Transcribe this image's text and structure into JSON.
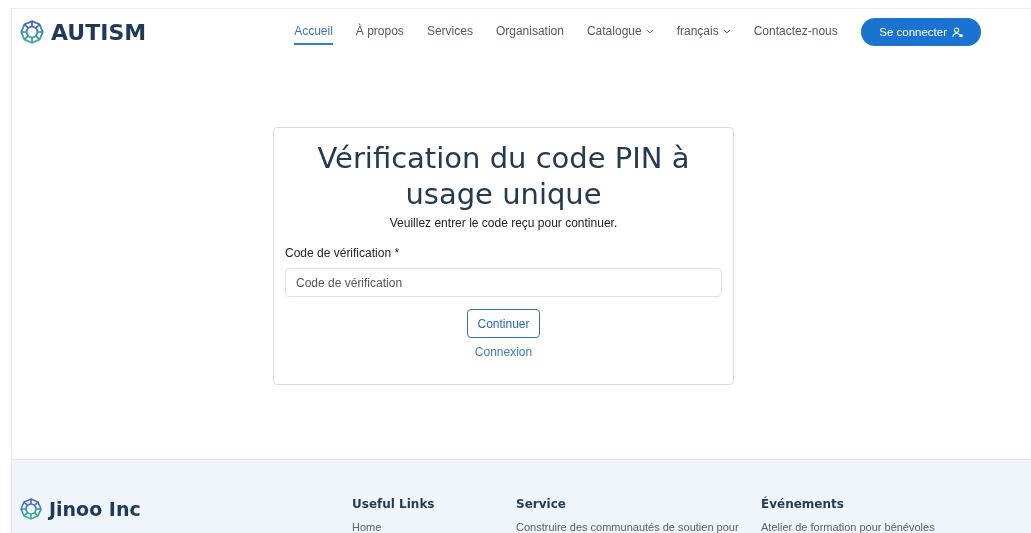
{
  "header": {
    "brand": "AUTISM",
    "nav": [
      {
        "label": "Accueil",
        "selected": true,
        "dropdown": false
      },
      {
        "label": "À propos",
        "selected": false,
        "dropdown": false
      },
      {
        "label": "Services",
        "selected": false,
        "dropdown": false
      },
      {
        "label": "Organisation",
        "selected": false,
        "dropdown": false
      },
      {
        "label": "Catalogue",
        "selected": false,
        "dropdown": true
      },
      {
        "label": "français",
        "selected": false,
        "dropdown": true
      },
      {
        "label": "Contactez-nous",
        "selected": false,
        "dropdown": false
      }
    ],
    "login_button": "Se connecter"
  },
  "card": {
    "title": "Vérification du code PIN à usage unique",
    "subtitle": "Veuillez entrer le code reçu pour continuer.",
    "field_label": "Code de vérification *",
    "placeholder": "Code de vérification",
    "submit": "Continuer",
    "link": "Connexion"
  },
  "footer": {
    "brand": "Jinoo Inc",
    "columns": [
      {
        "heading": "Useful Links",
        "first_item": "Home"
      },
      {
        "heading": "Service",
        "first_item": "Construire des communautés de soutien pour"
      },
      {
        "heading": "Événements",
        "first_item": "Atelier de formation pour bénévoles"
      }
    ]
  }
}
